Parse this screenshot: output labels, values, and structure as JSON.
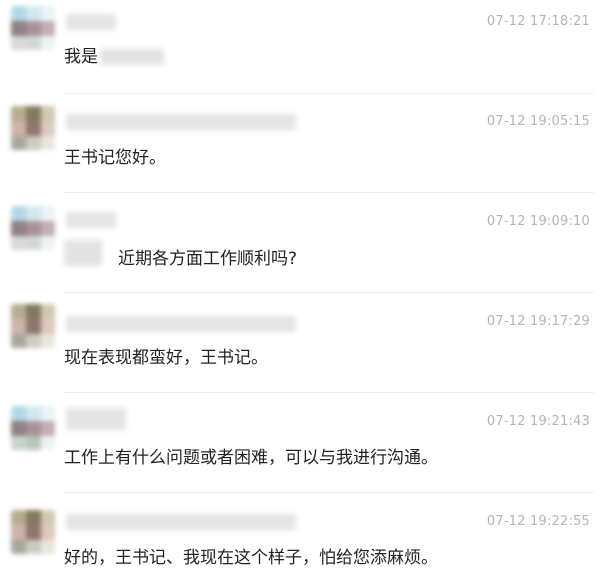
{
  "messages": [
    {
      "time": "07-12 17:18:21",
      "text": "我是",
      "avatar_colors": [
        "#a7d3e2",
        "#c9e3ec",
        "#e8f3f7",
        "#7c6b70",
        "#9b7f86",
        "#b7a1a6",
        "#d3d3d3",
        "#c8d2d0",
        "#eef2f1"
      ]
    },
    {
      "time": "07-12 19:05:15",
      "text": "王书记您好。",
      "avatar_colors": [
        "#a8a07e",
        "#6e6247",
        "#c9c1a2",
        "#c4a89a",
        "#7d5f55",
        "#d8c0b2",
        "#9c978d",
        "#c7c2b8",
        "#e6e1d8"
      ]
    },
    {
      "time": "07-12 19:09:10",
      "text": "近期各方面工作顺利吗?",
      "avatar_colors": [
        "#a7d3e2",
        "#c9e3ec",
        "#e8f3f7",
        "#7c6b70",
        "#9b7f86",
        "#b7a1a6",
        "#d3d3d3",
        "#c8d2d0",
        "#eef2f1"
      ]
    },
    {
      "time": "07-12 19:17:29",
      "text": "现在表现都蛮好，王书记。",
      "avatar_colors": [
        "#a8a07e",
        "#6e6247",
        "#c9c1a2",
        "#c4a89a",
        "#7d5f55",
        "#d8c0b2",
        "#9c978d",
        "#c7c2b8",
        "#e6e1d8"
      ]
    },
    {
      "time": "07-12 19:21:43",
      "text": "工作上有什么问题或者困难，可以与我进行沟通。",
      "avatar_colors": [
        "#a7d3e2",
        "#c9e3ec",
        "#e8f3f7",
        "#7c6b70",
        "#9b7f86",
        "#b7a1a6",
        "#bfcfc3",
        "#a8c0ad",
        "#eef2f1"
      ]
    },
    {
      "time": "07-12 19:22:55",
      "text": "好的，王书记、我现在这个样子，怕给您添麻烦。",
      "avatar_colors": [
        "#a8a07e",
        "#6e6247",
        "#c9c1a2",
        "#c4a89a",
        "#7d5f55",
        "#d8c0b2",
        "#9c978d",
        "#c7c2b8",
        "#e6e1d8"
      ]
    }
  ]
}
